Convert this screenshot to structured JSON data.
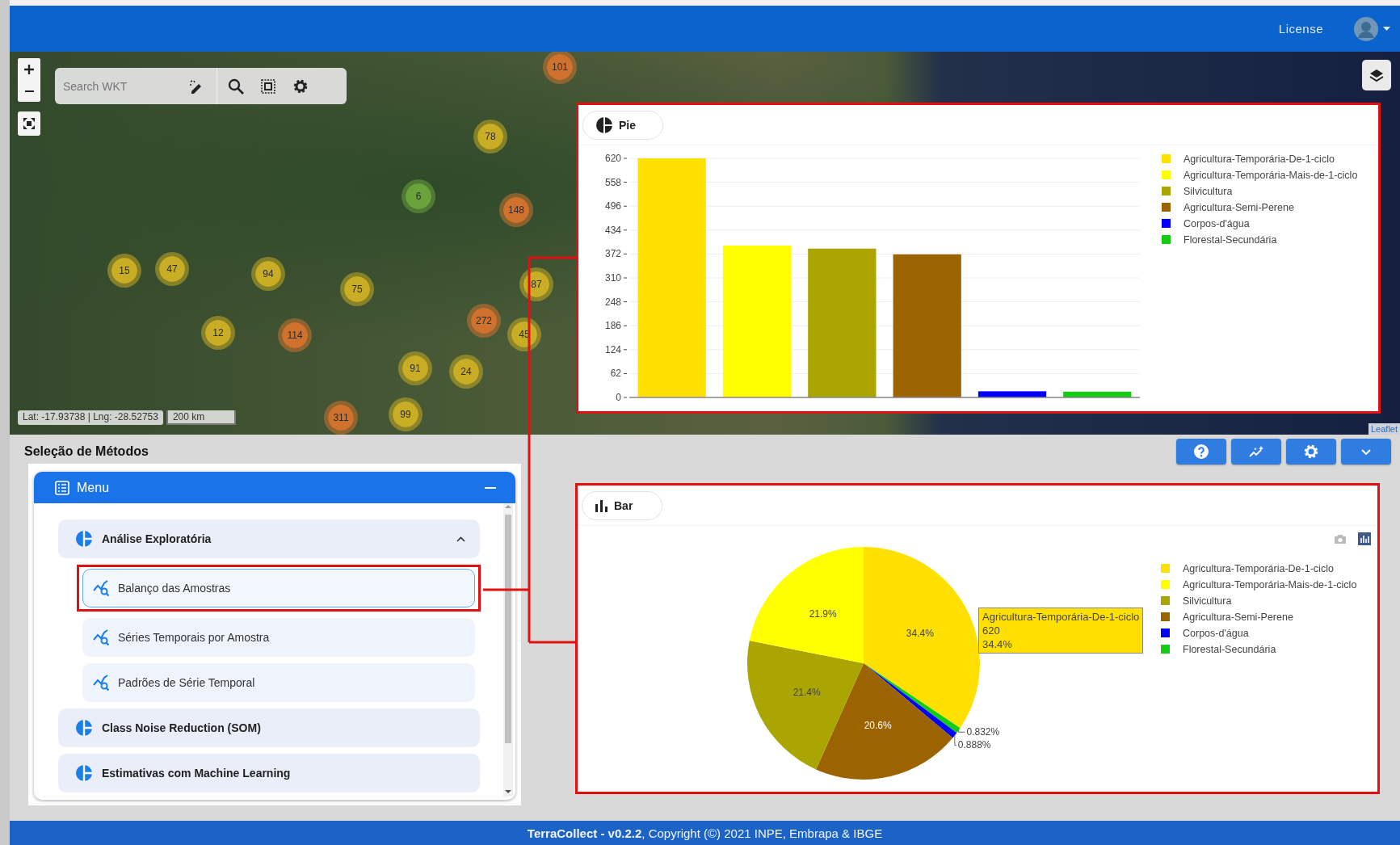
{
  "topbar": {
    "license_link": "License"
  },
  "map": {
    "search": {
      "placeholder": "Search WKT"
    },
    "markers": [
      {
        "count": "101",
        "color": "#d0722e"
      },
      {
        "count": "78",
        "color": "#c9ad24"
      },
      {
        "count": "6",
        "color": "#6aa23c"
      },
      {
        "count": "148",
        "color": "#d0722e"
      },
      {
        "count": "15",
        "color": "#c9ad24"
      },
      {
        "count": "47",
        "color": "#c9ad24"
      },
      {
        "count": "94",
        "color": "#c9ad24"
      },
      {
        "count": "75",
        "color": "#c9ad24"
      },
      {
        "count": "87",
        "color": "#c9ad24"
      },
      {
        "count": "272",
        "color": "#d0722e"
      },
      {
        "count": "12",
        "color": "#c9ad24"
      },
      {
        "count": "114",
        "color": "#d0722e"
      },
      {
        "count": "45",
        "color": "#c9ad24"
      },
      {
        "count": "91",
        "color": "#c9ad24"
      },
      {
        "count": "24",
        "color": "#c9ad24"
      },
      {
        "count": "311",
        "color": "#d0722e"
      },
      {
        "count": "99",
        "color": "#c9ad24"
      }
    ],
    "coordinates": "Lat: -17.93738 | Lng: -28.52753",
    "scale": "200 km",
    "attribution": "Leaflet",
    "overlay_panel": {
      "toggle": {
        "label": "Pie",
        "kind": "pie"
      },
      "modebar": false,
      "chart_data": {
        "type": "bar",
        "grid": true,
        "ylim": [
          0,
          620
        ],
        "yticks": [
          0,
          62,
          124,
          186,
          248,
          310,
          372,
          434,
          496,
          558,
          620
        ],
        "series": [
          {
            "name": "Agricultura-Temporária-De-1-ciclo",
            "color": "#ffe000",
            "values": [
              620
            ]
          },
          {
            "name": "Agricultura-Temporária-Mais-de-1-ciclo",
            "color": "#ffff00",
            "values": [
              394
            ]
          },
          {
            "name": "Silvicultura",
            "color": "#aaa500",
            "values": [
              386
            ]
          },
          {
            "name": "Agricultura-Semi-Perene",
            "color": "#9c6400",
            "values": [
              371
            ]
          },
          {
            "name": "Corpos-d'água",
            "color": "#0000ff",
            "values": [
              16
            ]
          },
          {
            "name": "Florestal-Secundária",
            "color": "#14cc14",
            "values": [
              15
            ]
          }
        ]
      }
    }
  },
  "methods": {
    "title": "Seleção de Métodos",
    "menu": {
      "title": "Menu",
      "groups": [
        {
          "label": "Análise Exploratória",
          "expanded": true,
          "children": [
            {
              "label": "Balanço das Amostras",
              "selected": true
            },
            {
              "label": "Séries Temporais por Amostra",
              "selected": false
            },
            {
              "label": "Padrões de Série Temporal",
              "selected": false
            }
          ]
        },
        {
          "label": "Class Noise Reduction (SOM)",
          "expanded": false
        },
        {
          "label": "Estimativas com Machine Learning",
          "expanded": false
        }
      ]
    }
  },
  "results_panel": {
    "toggle": {
      "label": "Bar",
      "kind": "bar"
    },
    "modebar": true,
    "chart_data": {
      "type": "pie",
      "categories": [
        "Agricultura-Temporária-De-1-ciclo",
        "Agricultura-Temporária-Mais-de-1-ciclo",
        "Silvicultura",
        "Agricultura-Semi-Perene",
        "Corpos-d'água",
        "Florestal-Secundária"
      ],
      "values": [
        34.4,
        21.9,
        21.4,
        20.6,
        0.888,
        0.832
      ],
      "colors": [
        "#ffe000",
        "#ffff00",
        "#aaa500",
        "#9c6400",
        "#0000ff",
        "#14cc14"
      ],
      "value_labels": [
        "34.4%",
        "21.9%",
        "21.4%",
        "20.6%",
        "0.888%",
        "0.832%"
      ]
    },
    "tooltip": {
      "lines": [
        "Agricultura-Temporária-De-1-ciclo",
        "620",
        "34.4%"
      ]
    }
  },
  "footer": "**TerraCollect - v0.2.2**, Copyright (©) 2021 INPE, Embrapa & IBGE"
}
